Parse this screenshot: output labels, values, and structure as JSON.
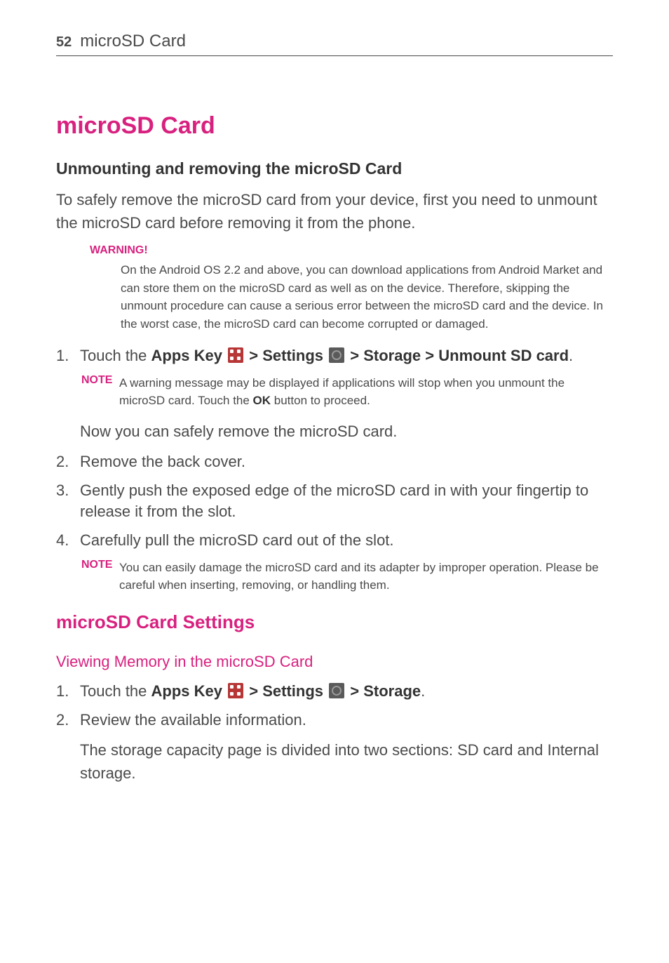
{
  "header": {
    "page_number": "52",
    "title": "microSD Card"
  },
  "main": {
    "title": "microSD Card",
    "subtitle": "Unmounting and removing the microSD Card",
    "intro": "To safely remove the microSD card from your device, first you need to unmount the microSD card before removing it from the phone.",
    "warning": {
      "label": "WARNING!",
      "text": "On the Android OS  2.2 and above, you can download applications from Android Market and can store them on the microSD card as well as on the device. Therefore, skipping the unmount procedure can cause a serious error between the microSD card and the device. In the worst case, the microSD card can become corrupted or damaged."
    },
    "step1": {
      "num": "1.",
      "prefix": "Touch the ",
      "apps_key": "Apps Key",
      "gt1": " > ",
      "settings": "Settings",
      "gt2": " > ",
      "storage": "Storage",
      "gt3": " > ",
      "unmount": "Unmount SD card",
      "period": "."
    },
    "note1": {
      "label": "NOTE",
      "text_pre": "A warning message may be displayed if applications will stop when you unmount the microSD card. Touch the ",
      "ok": "OK",
      "text_post": " button to proceed."
    },
    "step1_followup": "Now you can safely remove the microSD card.",
    "step2": {
      "num": "2.",
      "text": "Remove the back cover."
    },
    "step3": {
      "num": "3.",
      "text": "Gently push the exposed edge of the microSD card in with your fingertip to release it from the slot."
    },
    "step4": {
      "num": "4.",
      "text": "Carefully pull the microSD card out of the slot."
    },
    "note2": {
      "label": "NOTE",
      "text": "You can easily damage the microSD card and its adapter by improper operation. Please be careful when inserting, removing, or handling them."
    }
  },
  "section2": {
    "title": "microSD Card Settings",
    "subtitle": "Viewing Memory in the microSD Card",
    "step1": {
      "num": "1.",
      "prefix": "Touch the ",
      "apps_key": "Apps Key",
      "gt1": " > ",
      "settings": "Settings",
      "gt2": " > ",
      "storage": "Storage",
      "period": "."
    },
    "step2": {
      "num": "2.",
      "text": "Review the available information."
    },
    "step2_followup": "The storage capacity page is divided into two sections: SD card and Internal storage."
  }
}
